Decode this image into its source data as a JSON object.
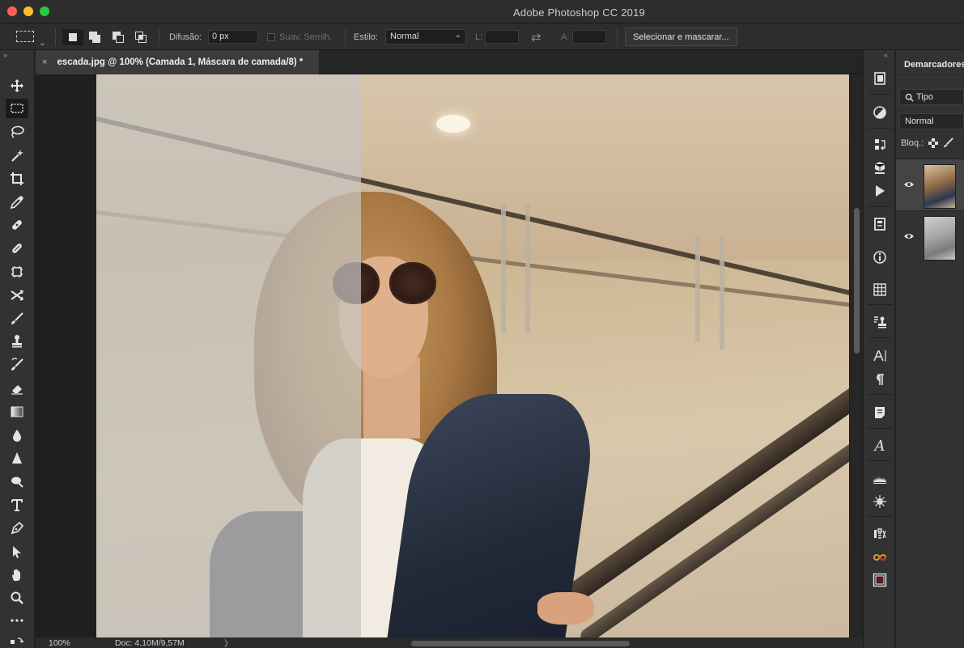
{
  "window": {
    "title": "Adobe Photoshop CC 2019"
  },
  "options_bar": {
    "feather_label": "Difusão:",
    "feather_value": "0 px",
    "anti_alias_label": "Suav. Serrilh.",
    "style_label": "Estilo:",
    "style_value": "Normal",
    "width_label": "L:",
    "width_value": "",
    "height_label": "A:",
    "height_value": "",
    "select_mask_button": "Selecionar e mascarar..."
  },
  "document": {
    "tab_title": "escada.jpg @ 100% (Camada 1, Máscara de camada/8) *",
    "close_glyph": "×"
  },
  "status": {
    "zoom": "100%",
    "doc_info": "Doc: 4,10M/9,57M",
    "arrow": "〉"
  },
  "layers_panel": {
    "tab_title": "Demarcadores",
    "kind_filter": "Tipo",
    "blend_mode": "Normal",
    "lock_label": "Bloq.:"
  },
  "toolbar": {
    "tools": [
      "move-tool",
      "marquee-tool",
      "lasso-tool",
      "magic-wand-tool",
      "crop-tool",
      "eyedropper-tool",
      "spot-healing-tool",
      "healing-tool",
      "patch-tool",
      "content-aware-move-tool",
      "brush-tool",
      "clone-stamp-tool",
      "history-brush-tool",
      "eraser-tool",
      "gradient-tool",
      "blur-tool",
      "sharpen-tool",
      "dodge-tool",
      "type-tool",
      "pen-tool",
      "path-selection-tool",
      "hand-tool",
      "zoom-tool",
      "more-tools"
    ]
  },
  "colors": {
    "chrome": "#323232",
    "dark_chrome": "#2d2d2d",
    "canvas_bg": "#262626",
    "accent_selected": "#444444"
  }
}
